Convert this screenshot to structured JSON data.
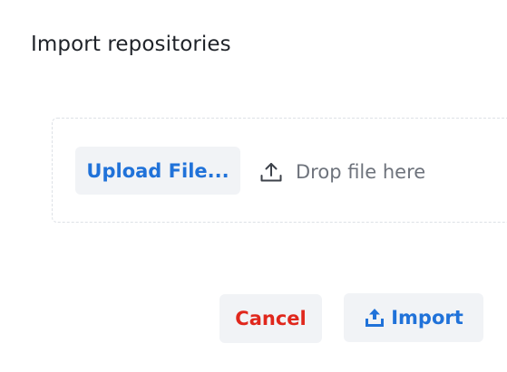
{
  "dialog": {
    "title": "Import repositories"
  },
  "dropzone": {
    "upload_button_label": "Upload File...",
    "drop_hint": "Drop file here",
    "hint_icon": "upload-icon"
  },
  "actions": {
    "cancel_label": "Cancel",
    "import_label": "Import",
    "import_icon": "import-upload-icon"
  },
  "colors": {
    "accent_blue": "#2072d9",
    "danger_red": "#e0271c",
    "button_bg": "#f1f3f6",
    "hint_gray": "#6e737c",
    "title_color": "#1f2329"
  }
}
